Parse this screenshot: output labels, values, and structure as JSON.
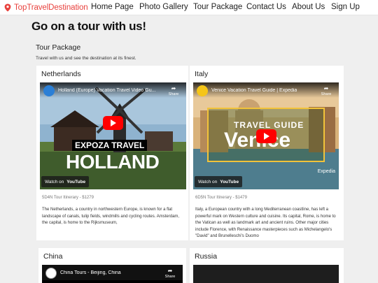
{
  "navbar": {
    "brand": "TopTravelDestination",
    "links": [
      "Home Page",
      "Photo Gallery",
      "Tour Package",
      "Contact Us",
      "About Us",
      "Sign Up"
    ]
  },
  "page": {
    "title": "Go on a tour with us!",
    "section_title": "Tour Package",
    "section_subtitle": "Travel with us and see the destination at its finest."
  },
  "cards": [
    {
      "name": "Netherlands",
      "video_title": "Holland (Europe) Vacation Travel Video Gu...",
      "overlay_brand": "EXPOZA TRAVEL",
      "overlay_text": "HOLLAND",
      "itinerary": "5D4N Tour Itinerary - $1279",
      "description": "The Netherlands, a country in northwestern Europe, is known for a flat landscape of canals, tulip fields, windmills and cycling routes. Amsterdam, the capital, is home to the Rijksmuseum,"
    },
    {
      "name": "Italy",
      "video_title": "Venice Vacation Travel Guide | Expedia",
      "overlay_brand": "TRAVEL GUIDE",
      "overlay_text": "Venice",
      "overlay_watermark": "Expedia",
      "itinerary": "6D5N Tour Itinerary - $1479",
      "description": "Italy, a European country with a long Mediterranean coastline, has left a powerful mark on Western culture and cuisine. Its capital, Rome, is home to the Vatican as well as landmark art and ancient ruins. Other major cities include Florence, with Renaissance masterpieces such as Michelangelo's \"David\" and Brunelleschi's Duomo"
    },
    {
      "name": "China",
      "video_title": "China Tours - Beijing, China"
    },
    {
      "name": "Russia"
    }
  ],
  "video_player": {
    "share_label": "Share",
    "watch_on": "Watch on",
    "youtube": "YouTube"
  },
  "colors": {
    "brand": "#e8413d",
    "background": "#efefef",
    "card": "#ffffff",
    "play_button": "#ff0000"
  }
}
